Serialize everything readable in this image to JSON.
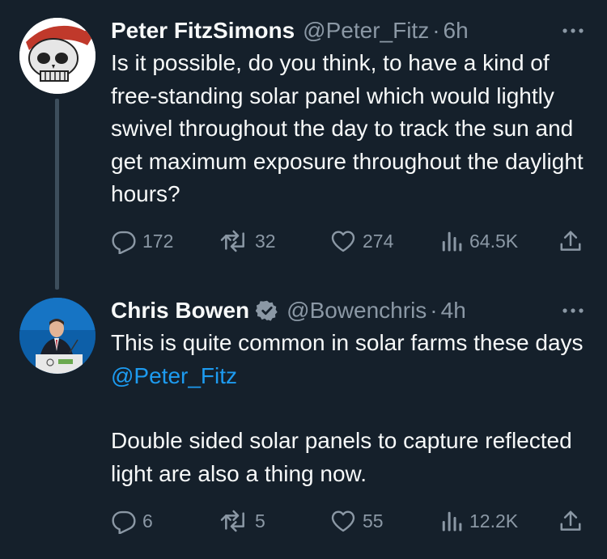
{
  "tweets": [
    {
      "author_name": "Peter FitzSimons",
      "handle": "@Peter_Fitz",
      "separator": "·",
      "time": "6h",
      "text": "Is it possible, do you think, to have a kind of free-standing solar panel which would lightly swivel throughout the day to track the sun and get maximum exposure throughout the daylight hours?",
      "avatar_icon": "skull-pirate-avatar",
      "replies": "172",
      "retweets": "32",
      "likes": "274",
      "views": "64.5K"
    },
    {
      "author_name": "Chris Bowen",
      "verified": true,
      "handle": "@Bowenchris",
      "separator": "·",
      "time": "4h",
      "text_part1": "This is quite common in solar farms these days ",
      "mention": "@Peter_Fitz",
      "text_part2": "Double sided solar panels to capture reflected light are also a thing now.",
      "avatar_icon": "person-at-podium-avatar",
      "replies": "6",
      "retweets": "5",
      "likes": "55",
      "views": "12.2K"
    }
  ],
  "colors": {
    "background": "#15202b",
    "text": "#f7f9f9",
    "muted": "#8b98a5",
    "accent": "#1d9bf0",
    "thread_line": "#3d4e5c"
  }
}
